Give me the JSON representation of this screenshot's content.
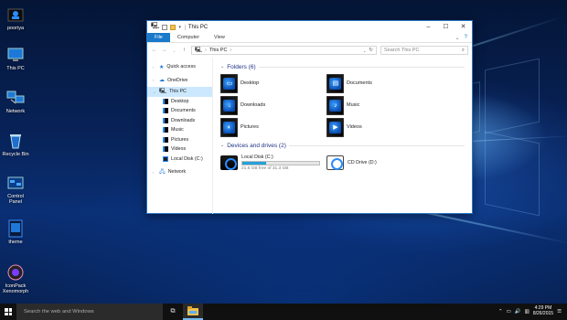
{
  "desktop_icons": [
    {
      "label": "pooriya",
      "icon": "user-folder-icon"
    },
    {
      "label": "This PC",
      "icon": "computer-icon"
    },
    {
      "label": "Network",
      "icon": "network-icon"
    },
    {
      "label": "Recycle Bin",
      "icon": "recycle-bin-icon"
    },
    {
      "label": "Control Panel",
      "icon": "control-panel-icon"
    },
    {
      "label": "theme",
      "icon": "theme-file-icon"
    },
    {
      "label": "IconPack Xenomorph",
      "icon": "iconpack-icon"
    }
  ],
  "window": {
    "title": "This PC",
    "accent": "#1979ca",
    "ribbon_tabs": [
      "File",
      "Computer",
      "View"
    ],
    "address": {
      "location": "This PC"
    },
    "search": {
      "placeholder": "Search This PC"
    }
  },
  "nav": {
    "items": [
      {
        "label": "Quick access",
        "level": 1,
        "icon": "star-icon",
        "selected": false
      },
      {
        "label": "OneDrive",
        "level": 1,
        "icon": "cloud-icon",
        "selected": false
      },
      {
        "label": "This PC",
        "level": 1,
        "icon": "computer-icon",
        "selected": true
      },
      {
        "label": "Desktop",
        "level": 2,
        "icon": "folder-icon",
        "selected": false
      },
      {
        "label": "Documents",
        "level": 2,
        "icon": "folder-icon",
        "selected": false
      },
      {
        "label": "Downloads",
        "level": 2,
        "icon": "folder-icon",
        "selected": false
      },
      {
        "label": "Music",
        "level": 2,
        "icon": "folder-icon",
        "selected": false
      },
      {
        "label": "Pictures",
        "level": 2,
        "icon": "folder-icon",
        "selected": false
      },
      {
        "label": "Videos",
        "level": 2,
        "icon": "folder-icon",
        "selected": false
      },
      {
        "label": "Local Disk (C:)",
        "level": 2,
        "icon": "drive-icon",
        "selected": false
      },
      {
        "label": "Network",
        "level": 1,
        "icon": "network-icon",
        "selected": false
      }
    ]
  },
  "content": {
    "folders_header": "Folders (6)",
    "folders": [
      {
        "label": "Desktop",
        "icon": "desktop-folder-icon",
        "sym": "▭"
      },
      {
        "label": "Documents",
        "icon": "documents-folder-icon",
        "sym": "▤"
      },
      {
        "label": "Downloads",
        "icon": "downloads-folder-icon",
        "sym": "↓"
      },
      {
        "label": "Music",
        "icon": "music-folder-icon",
        "sym": "♪"
      },
      {
        "label": "Pictures",
        "icon": "pictures-folder-icon",
        "sym": "◐"
      },
      {
        "label": "Videos",
        "icon": "videos-folder-icon",
        "sym": "▶"
      }
    ],
    "devices_header": "Devices and drives (2)",
    "drives": [
      {
        "label": "Local Disk (C:)",
        "detail": "21.6 GB free of 31.3 GB",
        "used_fraction": 0.31,
        "icon": "hard-drive-icon"
      },
      {
        "label": "CD Drive (D:)",
        "detail": "",
        "icon": "cd-drive-icon"
      }
    ]
  },
  "taskbar": {
    "search_placeholder": "Search the web and Windows",
    "time": "4:29 PM",
    "date": "8/26/2015"
  }
}
